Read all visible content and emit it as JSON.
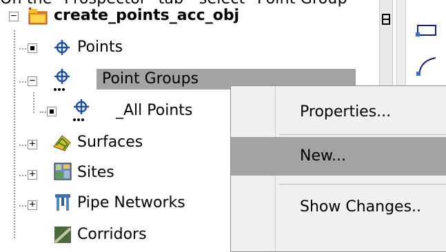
{
  "caption": "On the \"Prospector\" tab - select \"Point Group\"",
  "tree": {
    "root": {
      "label": "create_points_acc_obj",
      "expander": "−"
    },
    "items": [
      {
        "label": "Points",
        "icon": "points-icon",
        "expander": ""
      },
      {
        "label": "Point Groups",
        "icon": "point-groups-icon",
        "expander": "−",
        "selected": true
      },
      {
        "label": "_All Points",
        "icon": "all-points-icon",
        "expander": ""
      },
      {
        "label": "Surfaces",
        "icon": "surfaces-icon",
        "expander": "+"
      },
      {
        "label": "Sites",
        "icon": "sites-icon",
        "expander": "+"
      },
      {
        "label": "Pipe Networks",
        "icon": "pipe-networks-icon",
        "expander": "+"
      },
      {
        "label": "Corridors",
        "icon": "corridors-icon",
        "expander": ""
      }
    ]
  },
  "context_menu": {
    "items": [
      {
        "label": "Properties..."
      },
      {
        "label": "New..."
      },
      {
        "label": "Show Changes.."
      }
    ],
    "active_index": 1
  },
  "colors": {
    "selection": "#a3a3a3",
    "menu_bg": "#f0f0f0",
    "icon_blue": "#1f4fa8"
  }
}
